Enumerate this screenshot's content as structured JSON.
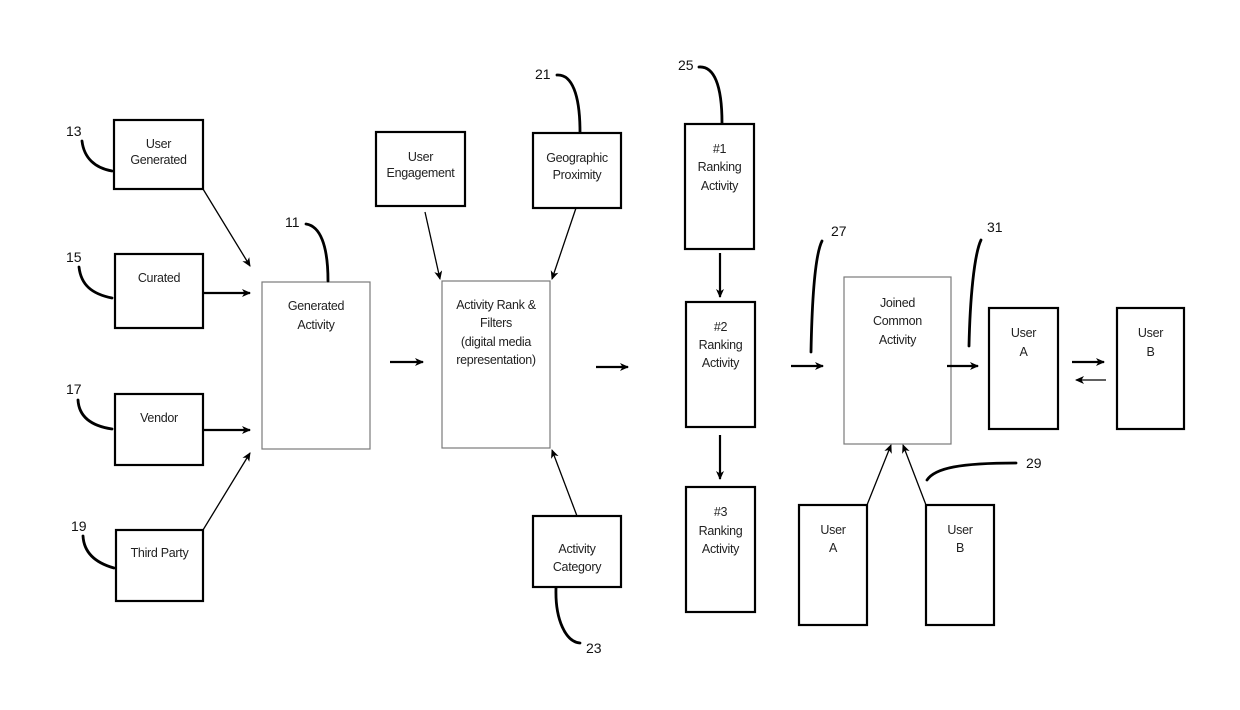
{
  "diagram": {
    "nodes": {
      "user_generated": {
        "lines": [
          "User",
          "Generated"
        ],
        "ref": "13"
      },
      "curated": {
        "lines": [
          "Curated"
        ],
        "ref": "15"
      },
      "vendor": {
        "lines": [
          "Vendor"
        ],
        "ref": "17"
      },
      "third_party": {
        "lines": [
          "Third Party"
        ],
        "ref": "19"
      },
      "generated_activity": {
        "lines": [
          "Generated",
          "Activity"
        ],
        "ref": "11"
      },
      "user_engagement": {
        "lines": [
          "User",
          "Engagement"
        ]
      },
      "geographic_proximity": {
        "lines": [
          "Geographic",
          "Proximity"
        ],
        "ref": "21"
      },
      "activity_rank_filters": {
        "lines": [
          "Activity Rank &",
          "Filters",
          "(digital media",
          "representation)"
        ]
      },
      "activity_category": {
        "lines": [
          "Activity",
          "Category"
        ],
        "ref": "23"
      },
      "ranking_1": {
        "lines": [
          "#1",
          "Ranking",
          "Activity"
        ],
        "ref": "25"
      },
      "ranking_2": {
        "lines": [
          "#2",
          "Ranking",
          "Activity"
        ]
      },
      "ranking_3": {
        "lines": [
          "#3",
          "Ranking",
          "Activity"
        ]
      },
      "joined_common_activity": {
        "lines": [
          "Joined",
          "Common",
          "Activity"
        ],
        "ref": "27"
      },
      "user_a_bottom": {
        "lines": [
          "User",
          "A"
        ]
      },
      "user_b_bottom": {
        "lines": [
          "User",
          "B"
        ],
        "ref": "29"
      },
      "user_a_right": {
        "lines": [
          "User",
          "A"
        ],
        "ref": "31"
      },
      "user_b_right": {
        "lines": [
          "User",
          "B"
        ]
      }
    },
    "edges": [
      {
        "from": "user_generated",
        "to": "generated_activity"
      },
      {
        "from": "curated",
        "to": "generated_activity"
      },
      {
        "from": "vendor",
        "to": "generated_activity"
      },
      {
        "from": "third_party",
        "to": "generated_activity"
      },
      {
        "from": "generated_activity",
        "to": "activity_rank_filters"
      },
      {
        "from": "user_engagement",
        "to": "activity_rank_filters"
      },
      {
        "from": "geographic_proximity",
        "to": "activity_rank_filters"
      },
      {
        "from": "activity_category",
        "to": "activity_rank_filters"
      },
      {
        "from": "activity_rank_filters",
        "to": "ranking_2"
      },
      {
        "from": "ranking_1",
        "to": "ranking_2"
      },
      {
        "from": "ranking_2",
        "to": "ranking_3"
      },
      {
        "from": "ranking_2",
        "to": "joined_common_activity"
      },
      {
        "from": "user_a_bottom",
        "to": "joined_common_activity"
      },
      {
        "from": "user_b_bottom",
        "to": "joined_common_activity"
      },
      {
        "from": "joined_common_activity",
        "to": "user_a_right"
      },
      {
        "from": "user_a_right",
        "to": "user_b_right"
      },
      {
        "from": "user_b_right",
        "to": "user_a_right"
      }
    ]
  }
}
